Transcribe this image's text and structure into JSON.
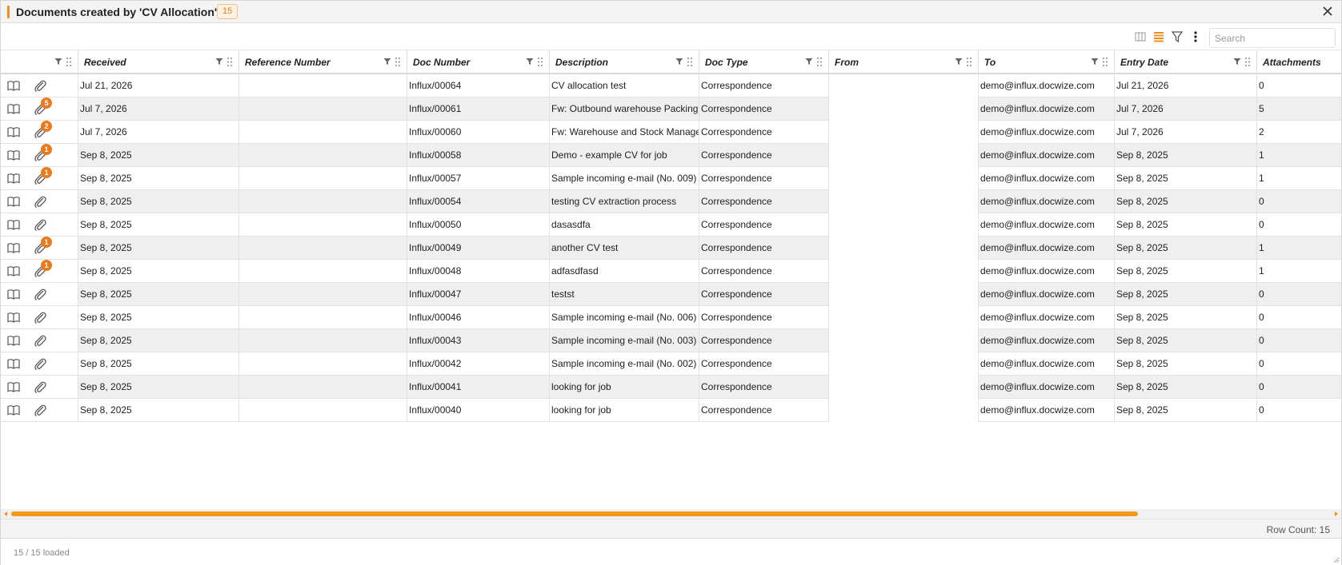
{
  "title": {
    "text": "Documents created by 'CV Allocation'",
    "badge": "15"
  },
  "toolbar": {
    "icons": [
      "columns-icon",
      "density-icon",
      "filter-icon",
      "more-vertical-icon"
    ],
    "search_placeholder": "Search",
    "accent_color": "#f0901e"
  },
  "columns": [
    {
      "key": "actions",
      "label": ""
    },
    {
      "key": "received",
      "label": "Received"
    },
    {
      "key": "reference_number",
      "label": "Reference Number"
    },
    {
      "key": "doc_number",
      "label": "Doc Number"
    },
    {
      "key": "description",
      "label": "Description"
    },
    {
      "key": "doc_type",
      "label": "Doc Type"
    },
    {
      "key": "from",
      "label": "From"
    },
    {
      "key": "to",
      "label": "To"
    },
    {
      "key": "entry_date",
      "label": "Entry Date"
    },
    {
      "key": "attachments",
      "label": "Attachments"
    }
  ],
  "rows": [
    {
      "received": "Jul 21, 2026",
      "reference_number": "",
      "doc_number": "Influx/00064",
      "description": "CV allocation test",
      "doc_type": "Correspondence",
      "from": "",
      "to": "demo@influx.docwize.com",
      "entry_date": "Jul 21, 2026",
      "attachments": "0",
      "badge": ""
    },
    {
      "received": "Jul 7, 2026",
      "reference_number": "",
      "doc_number": "Influx/00061",
      "description": "Fw: Outbound warehouse Packing",
      "doc_type": "Correspondence",
      "from": "",
      "to": "demo@influx.docwize.com",
      "entry_date": "Jul 7, 2026",
      "attachments": "5",
      "badge": "5"
    },
    {
      "received": "Jul 7, 2026",
      "reference_number": "",
      "doc_number": "Influx/00060",
      "description": "Fw: Warehouse and Stock Manage",
      "doc_type": "Correspondence",
      "from": "",
      "to": "demo@influx.docwize.com",
      "entry_date": "Jul 7, 2026",
      "attachments": "2",
      "badge": "2"
    },
    {
      "received": "Sep 8, 2025",
      "reference_number": "",
      "doc_number": "Influx/00058",
      "description": "Demo - example CV for job",
      "doc_type": "Correspondence",
      "from": "",
      "to": "demo@influx.docwize.com",
      "entry_date": "Sep 8, 2025",
      "attachments": "1",
      "badge": "1"
    },
    {
      "received": "Sep 8, 2025",
      "reference_number": "",
      "doc_number": "Influx/00057",
      "description": "Sample incoming e-mail (No. 009)",
      "doc_type": "Correspondence",
      "from": "",
      "to": "demo@influx.docwize.com",
      "entry_date": "Sep 8, 2025",
      "attachments": "1",
      "badge": "1"
    },
    {
      "received": "Sep 8, 2025",
      "reference_number": "",
      "doc_number": "Influx/00054",
      "description": "testing CV extraction process",
      "doc_type": "Correspondence",
      "from": "",
      "to": "demo@influx.docwize.com",
      "entry_date": "Sep 8, 2025",
      "attachments": "0",
      "badge": ""
    },
    {
      "received": "Sep 8, 2025",
      "reference_number": "",
      "doc_number": "Influx/00050",
      "description": "dasasdfa",
      "doc_type": "Correspondence",
      "from": "",
      "to": "demo@influx.docwize.com",
      "entry_date": "Sep 8, 2025",
      "attachments": "0",
      "badge": ""
    },
    {
      "received": "Sep 8, 2025",
      "reference_number": "",
      "doc_number": "Influx/00049",
      "description": "another CV test",
      "doc_type": "Correspondence",
      "from": "",
      "to": "demo@influx.docwize.com",
      "entry_date": "Sep 8, 2025",
      "attachments": "1",
      "badge": "1"
    },
    {
      "received": "Sep 8, 2025",
      "reference_number": "",
      "doc_number": "Influx/00048",
      "description": "adfasdfasd",
      "doc_type": "Correspondence",
      "from": "",
      "to": "demo@influx.docwize.com",
      "entry_date": "Sep 8, 2025",
      "attachments": "1",
      "badge": "1"
    },
    {
      "received": "Sep 8, 2025",
      "reference_number": "",
      "doc_number": "Influx/00047",
      "description": "testst",
      "doc_type": "Correspondence",
      "from": "",
      "to": "demo@influx.docwize.com",
      "entry_date": "Sep 8, 2025",
      "attachments": "0",
      "badge": ""
    },
    {
      "received": "Sep 8, 2025",
      "reference_number": "",
      "doc_number": "Influx/00046",
      "description": "Sample incoming e-mail (No. 006)",
      "doc_type": "Correspondence",
      "from": "",
      "to": "demo@influx.docwize.com",
      "entry_date": "Sep 8, 2025",
      "attachments": "0",
      "badge": ""
    },
    {
      "received": "Sep 8, 2025",
      "reference_number": "",
      "doc_number": "Influx/00043",
      "description": "Sample incoming e-mail (No. 003)",
      "doc_type": "Correspondence",
      "from": "",
      "to": "demo@influx.docwize.com",
      "entry_date": "Sep 8, 2025",
      "attachments": "0",
      "badge": ""
    },
    {
      "received": "Sep 8, 2025",
      "reference_number": "",
      "doc_number": "Influx/00042",
      "description": "Sample incoming e-mail (No. 002)",
      "doc_type": "Correspondence",
      "from": "",
      "to": "demo@influx.docwize.com",
      "entry_date": "Sep 8, 2025",
      "attachments": "0",
      "badge": ""
    },
    {
      "received": "Sep 8, 2025",
      "reference_number": "",
      "doc_number": "Influx/00041",
      "description": "looking for job",
      "doc_type": "Correspondence",
      "from": "",
      "to": "demo@influx.docwize.com",
      "entry_date": "Sep 8, 2025",
      "attachments": "0",
      "badge": ""
    },
    {
      "received": "Sep 8, 2025",
      "reference_number": "",
      "doc_number": "Influx/00040",
      "description": "looking for job",
      "doc_type": "Correspondence",
      "from": "",
      "to": "demo@influx.docwize.com",
      "entry_date": "Sep 8, 2025",
      "attachments": "0",
      "badge": ""
    }
  ],
  "status": {
    "row_count": "Row Count: 15",
    "loaded": "15 / 15 loaded"
  },
  "colors": {
    "accent": "#f0901e",
    "badge": "#ea7a1b",
    "row_alt": "#efefef"
  }
}
